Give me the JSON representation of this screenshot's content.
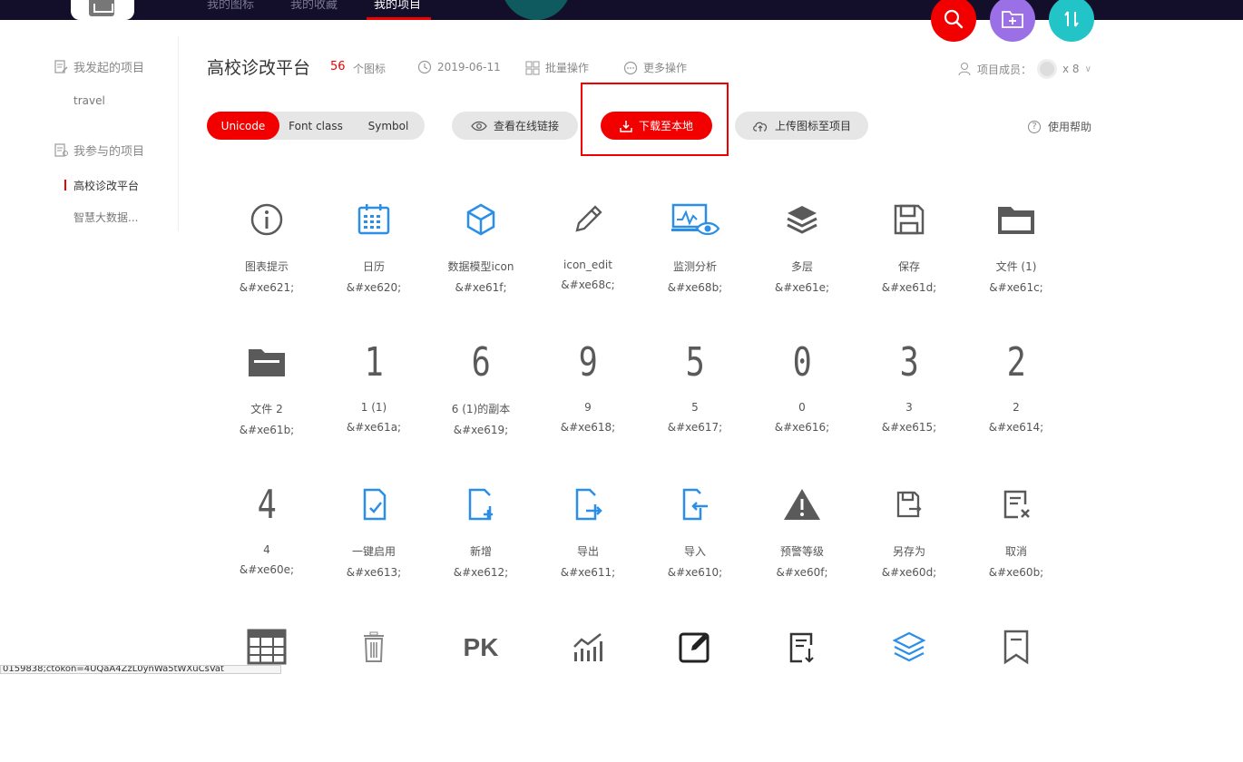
{
  "topnav": {
    "items": [
      "我的图标",
      "我的收藏",
      "我的项目"
    ]
  },
  "sidebar": {
    "initiated_label": "我发起的项目",
    "initiated_items": [
      "travel"
    ],
    "joined_label": "我参与的项目",
    "joined_items": [
      "高校诊改平台",
      "智慧大数据..."
    ]
  },
  "project": {
    "title": "高校诊改平台",
    "icon_count": "56",
    "icon_count_label": "个图标",
    "date": "2019-06-11",
    "batch_label": "批量操作",
    "more_label": "更多操作",
    "members_label": "项目成员：",
    "members_count": "x 8"
  },
  "toolbar": {
    "tabs": [
      "Unicode",
      "Font class",
      "Symbol"
    ],
    "view_link_label": "查看在线链接",
    "download_label": "下载至本地",
    "upload_label": "上传图标至项目",
    "help_label": "使用帮助"
  },
  "icons": [
    {
      "name": "图表提示",
      "code": "&#xe621;",
      "icon": "info-circle-icon"
    },
    {
      "name": "日历",
      "code": "&#xe620;",
      "icon": "calendar-icon"
    },
    {
      "name": "数据模型icon",
      "code": "&#xe61f;",
      "icon": "cube-icon"
    },
    {
      "name": "icon_edit",
      "code": "&#xe68c;",
      "icon": "pencil-icon"
    },
    {
      "name": "监测分析",
      "code": "&#xe68b;",
      "icon": "monitor-eye-icon"
    },
    {
      "name": "多层",
      "code": "&#xe61e;",
      "icon": "layers-icon"
    },
    {
      "name": "保存",
      "code": "&#xe61d;",
      "icon": "floppy-icon"
    },
    {
      "name": "文件 (1)",
      "code": "&#xe61c;",
      "icon": "folder-outline-icon"
    },
    {
      "name": "文件 2",
      "code": "&#xe61b;",
      "icon": "folder-filled-icon"
    },
    {
      "name": "1 (1)",
      "code": "&#xe61a;",
      "icon": "digit-1-icon",
      "digit": "1"
    },
    {
      "name": "6 (1)的副本",
      "code": "&#xe619;",
      "icon": "digit-6-icon",
      "digit": "6"
    },
    {
      "name": "9",
      "code": "&#xe618;",
      "icon": "digit-9-icon",
      "digit": "9"
    },
    {
      "name": "5",
      "code": "&#xe617;",
      "icon": "digit-5-icon",
      "digit": "5"
    },
    {
      "name": "0",
      "code": "&#xe616;",
      "icon": "digit-0-icon",
      "digit": "0"
    },
    {
      "name": "3",
      "code": "&#xe615;",
      "icon": "digit-3-icon",
      "digit": "3"
    },
    {
      "name": "2",
      "code": "&#xe614;",
      "icon": "digit-2-icon",
      "digit": "2"
    },
    {
      "name": "4",
      "code": "&#xe60e;",
      "icon": "digit-4-icon",
      "digit": "4"
    },
    {
      "name": "一键启用",
      "code": "&#xe613;",
      "icon": "doc-check-icon"
    },
    {
      "name": "新增",
      "code": "&#xe612;",
      "icon": "doc-plus-icon"
    },
    {
      "name": "导出",
      "code": "&#xe611;",
      "icon": "doc-export-icon"
    },
    {
      "name": "导入",
      "code": "&#xe610;",
      "icon": "doc-import-icon"
    },
    {
      "name": "预警等级",
      "code": "&#xe60f;",
      "icon": "warning-icon"
    },
    {
      "name": "另存为",
      "code": "&#xe60d;",
      "icon": "save-as-icon"
    },
    {
      "name": "取消",
      "code": "&#xe60b;",
      "icon": "doc-cancel-icon"
    },
    {
      "name": "",
      "code": "",
      "icon": "table-icon"
    },
    {
      "name": "",
      "code": "",
      "icon": "trash-icon"
    },
    {
      "name": "",
      "code": "",
      "icon": "pk-icon"
    },
    {
      "name": "",
      "code": "",
      "icon": "chart-trend-icon"
    },
    {
      "name": "",
      "code": "",
      "icon": "edit-square-icon"
    },
    {
      "name": "",
      "code": "",
      "icon": "doc-download-icon"
    },
    {
      "name": "",
      "code": "",
      "icon": "stack-icon"
    },
    {
      "name": "",
      "code": "",
      "icon": "bookmark-icon"
    }
  ],
  "status_url": "0159838;ctokon=4UQaA4ZzL0ynWa5tWXuCsVat",
  "colors": {
    "accent": "#f20000",
    "blue": "#2b8ee8",
    "gray": "#5a5a5a",
    "dark": "#130f2b"
  }
}
